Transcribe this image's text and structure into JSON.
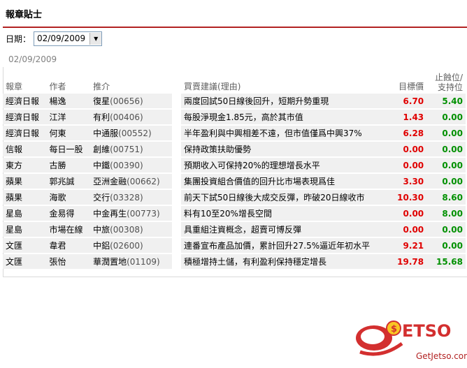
{
  "header": {
    "title": "報章貼士"
  },
  "date": {
    "label": "日期：",
    "selected": "02/09/2009",
    "display": "02/09/2009"
  },
  "table": {
    "columns": [
      "報章",
      "作者",
      "推介",
      "買賣建議(理由)",
      "目標價",
      "止蝕位/\n支持位"
    ],
    "rows": [
      {
        "paper": "經濟日報",
        "author": "楊逸",
        "stock": "復星",
        "code": "(00656)",
        "advice": "兩度回試50日線後回升，短期升勢重現",
        "target": "6.70",
        "stop": "5.40"
      },
      {
        "paper": "經濟日報",
        "author": "江洋",
        "stock": "有利",
        "code": "(00406)",
        "advice": "每股淨現金1.85元，高於其市值",
        "target": "1.43",
        "stop": "0.00"
      },
      {
        "paper": "經濟日報",
        "author": "何東",
        "stock": "中通服",
        "code": "(00552)",
        "advice": "半年盈利與中興相差不遠，但市值僅爲中興37%",
        "target": "6.28",
        "stop": "0.00"
      },
      {
        "paper": "信報",
        "author": "每日一股",
        "stock": "創維",
        "code": "(00751)",
        "advice": "保持政策扶助優勢",
        "target": "0.00",
        "stop": "0.00"
      },
      {
        "paper": "東方",
        "author": "古勝",
        "stock": "中鐵",
        "code": "(00390)",
        "advice": "預期收入可保持20%的理想增長水平",
        "target": "0.00",
        "stop": "0.00"
      },
      {
        "paper": "蘋果",
        "author": "郭兆誠",
        "stock": "亞洲金融",
        "code": "(00662)",
        "advice": "集團投資組合價值的回升比市場表現爲佳",
        "target": "3.30",
        "stop": "0.00"
      },
      {
        "paper": "蘋果",
        "author": "海歌",
        "stock": "交行",
        "code": "(03328)",
        "advice": "前天下試50日線後大成交反彈，昨破20日線收市",
        "target": "10.30",
        "stop": "8.60"
      },
      {
        "paper": "星島",
        "author": "金易得",
        "stock": "中金再生",
        "code": "(00773)",
        "advice": "料有10至20%增長空間",
        "target": "0.00",
        "stop": "8.00"
      },
      {
        "paper": "星島",
        "author": "市場在線",
        "stock": "中旅",
        "code": "(00308)",
        "advice": "具重組注資概念，超賣可博反彈",
        "target": "0.00",
        "stop": "0.00"
      },
      {
        "paper": "文匯",
        "author": "韋君",
        "stock": "中鋁",
        "code": "(02600)",
        "advice": "連番宣布產品加價，累計回升27.5%逼近年初水平",
        "target": "9.21",
        "stop": "0.00"
      },
      {
        "paper": "文匯",
        "author": "張怡",
        "stock": "華潤置地",
        "code": "(01109)",
        "advice": "積極增持土儲，有利盈利保持穩定增長",
        "target": "19.78",
        "stop": "15.68"
      }
    ]
  },
  "logo": {
    "brand": "ETSO",
    "site": "GetJetso.com"
  },
  "colors": {
    "accent": "#b22222",
    "target": "#e00000",
    "stop": "#009000",
    "row_bg": "#f0f0f0"
  }
}
